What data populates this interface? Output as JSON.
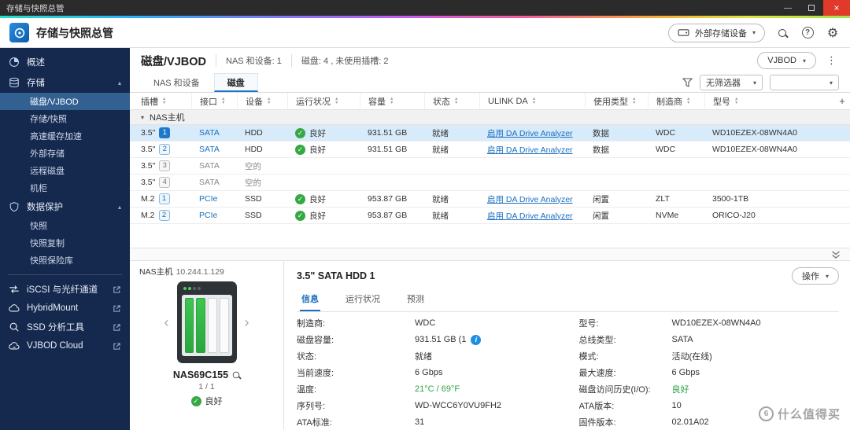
{
  "window": {
    "title": "存储与快照总管"
  },
  "icons": {
    "minimize": "—",
    "maximize": "",
    "close": "×",
    "help": "?",
    "gear": "⚙",
    "kebab": "⋮",
    "dropdown": "▾",
    "section_open": "▴",
    "group_caret": "▾",
    "sort_up": "▲",
    "sort_down": "▼",
    "plus": "+",
    "check": "✓",
    "info": "i",
    "left_arrow": "‹",
    "right_arrow": "›"
  },
  "header": {
    "title": "存储与快照总管",
    "external_device": "外部存储设备"
  },
  "sidebar": {
    "overview": "概述",
    "storage": {
      "label": "存储",
      "items": [
        "磁盘/VJBOD",
        "存储/快照",
        "高速缓存加速",
        "外部存储",
        "远程磁盘",
        "机柜"
      ]
    },
    "protection": {
      "label": "数据保护",
      "items": [
        "快照",
        "快照复制",
        "快照保险库"
      ]
    },
    "tools": [
      "iSCSI 与光纤通道",
      "HybridMount",
      "SSD 分析工具",
      "VJBOD Cloud"
    ]
  },
  "page": {
    "title": "磁盘/VJBOD",
    "meta_devices": "NAS 和设备: 1",
    "meta_disks": "磁盘: 4 , 未使用插槽: 2",
    "vjbod_button": "VJBOD"
  },
  "toolbar": {
    "tabs": [
      "NAS 和设备",
      "磁盘"
    ],
    "filter": "无筛选器",
    "filter2": ""
  },
  "table": {
    "columns": [
      "插槽",
      "接口",
      "设备",
      "运行状况",
      "容量",
      "状态",
      "ULINK DA",
      "使用类型",
      "制造商",
      "型号"
    ],
    "group": "NAS主机",
    "rows": [
      {
        "slot": "3.5\"",
        "bay": "1",
        "iface": "SATA",
        "device": "HDD",
        "health": "良好",
        "capacity": "931.51 GB",
        "status": "就绪",
        "ulink": "启用 DA Drive Analyzer",
        "usage": "数据",
        "mfr": "WDC",
        "model": "WD10EZEX-08WN4A0"
      },
      {
        "slot": "3.5\"",
        "bay": "2",
        "iface": "SATA",
        "device": "HDD",
        "health": "良好",
        "capacity": "931.51 GB",
        "status": "就绪",
        "ulink": "启用 DA Drive Analyzer",
        "usage": "数据",
        "mfr": "WDC",
        "model": "WD10EZEX-08WN4A0"
      },
      {
        "slot": "3.5\"",
        "bay": "3",
        "iface": "SATA",
        "device": "空的"
      },
      {
        "slot": "3.5\"",
        "bay": "4",
        "iface": "SATA",
        "device": "空的"
      },
      {
        "slot": "M.2",
        "bay": "1",
        "iface": "PCIe",
        "device": "SSD",
        "health": "良好",
        "capacity": "953.87 GB",
        "status": "就绪",
        "ulink": "启用 DA Drive Analyzer",
        "usage": "闲置",
        "mfr": "ZLT",
        "model": "3500-1TB"
      },
      {
        "slot": "M.2",
        "bay": "2",
        "iface": "PCIe",
        "device": "SSD",
        "health": "良好",
        "capacity": "953.87 GB",
        "status": "就绪",
        "ulink": "启用 DA Drive Analyzer",
        "usage": "闲置",
        "mfr": "NVMe",
        "model": "ORICO-J20"
      }
    ]
  },
  "nas": {
    "host": "NAS主机",
    "ip": "10.244.1.129",
    "name": "NAS69C155",
    "page": "1 / 1",
    "health": "良好"
  },
  "detail": {
    "title": "3.5\" SATA HDD 1",
    "action": "操作",
    "tabs": [
      "信息",
      "运行状况",
      "预测"
    ],
    "left": [
      {
        "label": "制造商:",
        "value": "WDC"
      },
      {
        "label": "磁盘容量:",
        "value": "931.51 GB (1"
      },
      {
        "label": "状态:",
        "value": "就绪"
      },
      {
        "label": "当前速度:",
        "value": "6 Gbps"
      },
      {
        "label": "温度:",
        "value": "21°C / 69°F"
      },
      {
        "label": "序列号:",
        "value": "WD-WCC6Y0VU9FH2"
      },
      {
        "label": "ATA标准:",
        "value": "31"
      }
    ],
    "right": [
      {
        "label": "型号:",
        "value": "WD10EZEX-08WN4A0"
      },
      {
        "label": "总线类型:",
        "value": "SATA"
      },
      {
        "label": "模式:",
        "value": "活动(在线)"
      },
      {
        "label": "最大速度:",
        "value": "6 Gbps"
      },
      {
        "label": "磁盘访问历史(I/O):",
        "value": "良好"
      },
      {
        "label": "ATA版本:",
        "value": "10"
      },
      {
        "label": "固件版本:",
        "value": "02.01A02"
      }
    ]
  },
  "watermark": "什么值得买"
}
